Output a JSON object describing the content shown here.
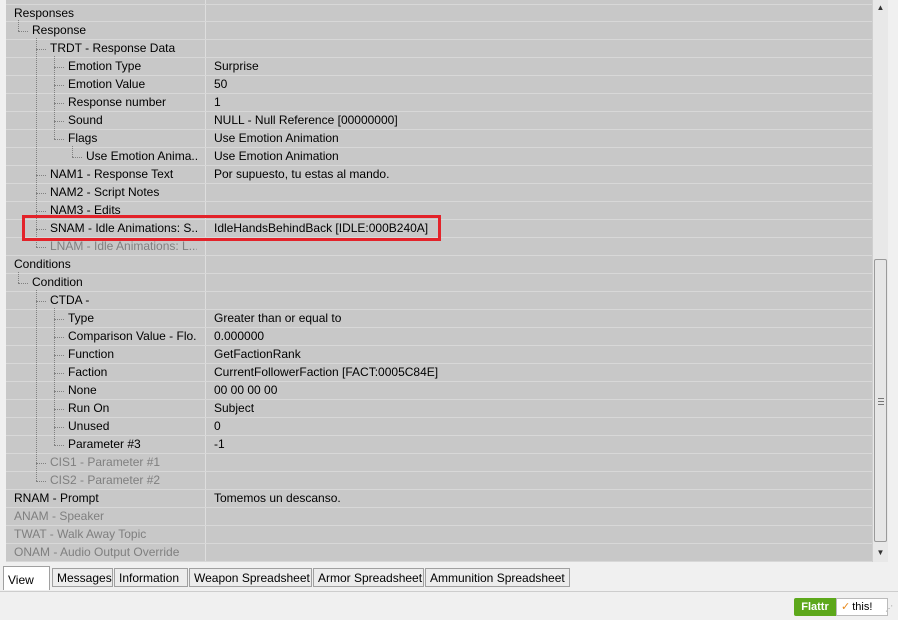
{
  "rows": [
    {
      "name": "Responses",
      "value": "",
      "grey": false
    },
    {
      "name": "Response",
      "value": "",
      "grey": false
    },
    {
      "name": "TRDT - Response Data",
      "value": "",
      "grey": false
    },
    {
      "name": "Emotion Type",
      "value": "Surprise",
      "grey": false
    },
    {
      "name": "Emotion Value",
      "value": "50",
      "grey": false
    },
    {
      "name": "Response number",
      "value": "1",
      "grey": false
    },
    {
      "name": "Sound",
      "value": "NULL - Null Reference [00000000]",
      "grey": false
    },
    {
      "name": "Flags",
      "value": "Use Emotion Animation",
      "grey": false
    },
    {
      "name": "Use Emotion Anima...",
      "value": "Use Emotion Animation",
      "grey": false
    },
    {
      "name": "NAM1 - Response Text",
      "value": "Por supuesto, tu estas al mando.",
      "grey": false
    },
    {
      "name": "NAM2 - Script Notes",
      "value": "",
      "grey": false
    },
    {
      "name": "NAM3 - Edits",
      "value": "",
      "grey": false
    },
    {
      "name": "SNAM - Idle Animations: S...",
      "value": "IdleHandsBehindBack [IDLE:000B240A]",
      "grey": false
    },
    {
      "name": "LNAM - Idle Animations: L...",
      "value": "",
      "grey": true
    },
    {
      "name": "Conditions",
      "value": "",
      "grey": false
    },
    {
      "name": "Condition",
      "value": "",
      "grey": false
    },
    {
      "name": "CTDA -",
      "value": "",
      "grey": false
    },
    {
      "name": "Type",
      "value": "Greater than or equal to",
      "grey": false
    },
    {
      "name": "Comparison Value - Flo...",
      "value": "0.000000",
      "grey": false
    },
    {
      "name": "Function",
      "value": "GetFactionRank",
      "grey": false
    },
    {
      "name": "Faction",
      "value": "CurrentFollowerFaction [FACT:0005C84E]",
      "grey": false
    },
    {
      "name": "None",
      "value": "00 00 00 00",
      "grey": false
    },
    {
      "name": "Run On",
      "value": "Subject",
      "grey": false
    },
    {
      "name": "Unused",
      "value": "0",
      "grey": false
    },
    {
      "name": "Parameter #3",
      "value": "-1",
      "grey": false
    },
    {
      "name": "CIS1 - Parameter #1",
      "value": "",
      "grey": true
    },
    {
      "name": "CIS2 - Parameter #2",
      "value": "",
      "grey": true
    },
    {
      "name": "RNAM - Prompt",
      "value": "Tomemos un descanso.",
      "grey": false
    },
    {
      "name": "ANAM - Speaker",
      "value": "",
      "grey": true
    },
    {
      "name": "TWAT - Walk Away Topic",
      "value": "",
      "grey": true
    },
    {
      "name": "ONAM - Audio Output Override",
      "value": "",
      "grey": true
    }
  ],
  "tabs": [
    "View",
    "Messages",
    "Information",
    "Weapon Spreadsheet",
    "Armor Spreadsheet",
    "Ammunition Spreadsheet"
  ],
  "active_tab": "View",
  "flattr": {
    "left": "Flattr",
    "right": "this!"
  },
  "colors": {
    "highlight": "#e3232a",
    "panel": "#c8c8c8",
    "flattr": "#5da81b"
  },
  "icons": {
    "scroll_up": "triangle-up-icon",
    "scroll_down": "triangle-down-icon",
    "flattr_check": "check-icon"
  }
}
